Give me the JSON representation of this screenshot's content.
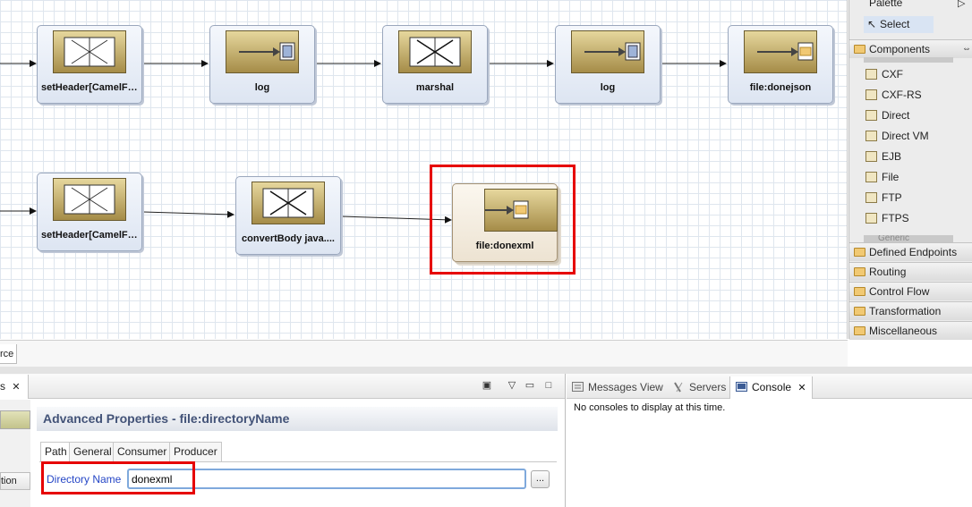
{
  "nodes_row1": [
    {
      "label": "setHeader[CamelFi...",
      "icon": "processor-icon"
    },
    {
      "label": "log",
      "icon": "endpoint-icon"
    },
    {
      "label": "marshal",
      "icon": "processor-icon"
    },
    {
      "label": "log",
      "icon": "endpoint-icon"
    },
    {
      "label": "file:donejson",
      "icon": "file-endpoint-icon"
    }
  ],
  "nodes_row2": [
    {
      "label": "setHeader[CamelFi...",
      "icon": "processor-icon"
    },
    {
      "label": "convertBody java....",
      "icon": "processor-icon"
    },
    {
      "label": "file:donexml",
      "icon": "file-endpoint-icon"
    }
  ],
  "palette": {
    "title": "Palette",
    "select_label": "Select",
    "components_label": "Components",
    "components": [
      "CXF",
      "CXF-RS",
      "Direct",
      "Direct VM",
      "EJB",
      "File",
      "FTP",
      "FTPS"
    ],
    "partial_item": "Generic",
    "drawers": [
      "Defined Endpoints",
      "Routing",
      "Control Flow",
      "Transformation",
      "Miscellaneous"
    ]
  },
  "editor_tab_fragment": "rce",
  "properties": {
    "tab_fragment": "s",
    "left_fragment": "tion",
    "title": "Advanced Properties - file:directoryName",
    "subtabs": [
      "Path",
      "General",
      "Consumer",
      "Producer"
    ],
    "field_label": "Directory Name",
    "field_value": "donexml",
    "browse_label": "..."
  },
  "console": {
    "tabs": [
      "Messages View",
      "Servers",
      "Console"
    ],
    "message": "No consoles to display at this time."
  },
  "colors": {
    "highlight": "#e60000",
    "link": "#2546c6",
    "title": "#435378"
  }
}
